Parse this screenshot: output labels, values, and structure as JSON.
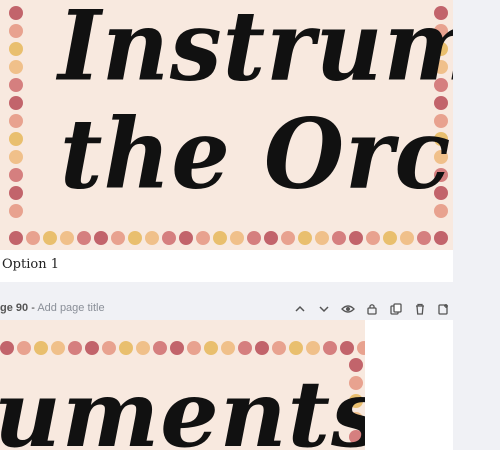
{
  "pages": [
    {
      "artwork_line1": "Instrument",
      "artwork_line2": "the Orchest",
      "caption": "Option 1"
    },
    {
      "header_number": "ge 90",
      "header_separator": " - ",
      "title_placeholder": "Add page title",
      "artwork_line1": "uments of"
    }
  ],
  "toolbar_icons": [
    "chevron-up-icon",
    "chevron-down-icon",
    "eye-icon",
    "lock-icon",
    "duplicate-icon",
    "trash-icon",
    "add-page-icon"
  ],
  "colors": {
    "background": "#f0f1f5",
    "artwork_bg": "#f8e9df",
    "dot_palette": [
      "#c2646b",
      "#e8a28f",
      "#e9bf6e",
      "#f0c08a",
      "#d57f7f"
    ]
  }
}
